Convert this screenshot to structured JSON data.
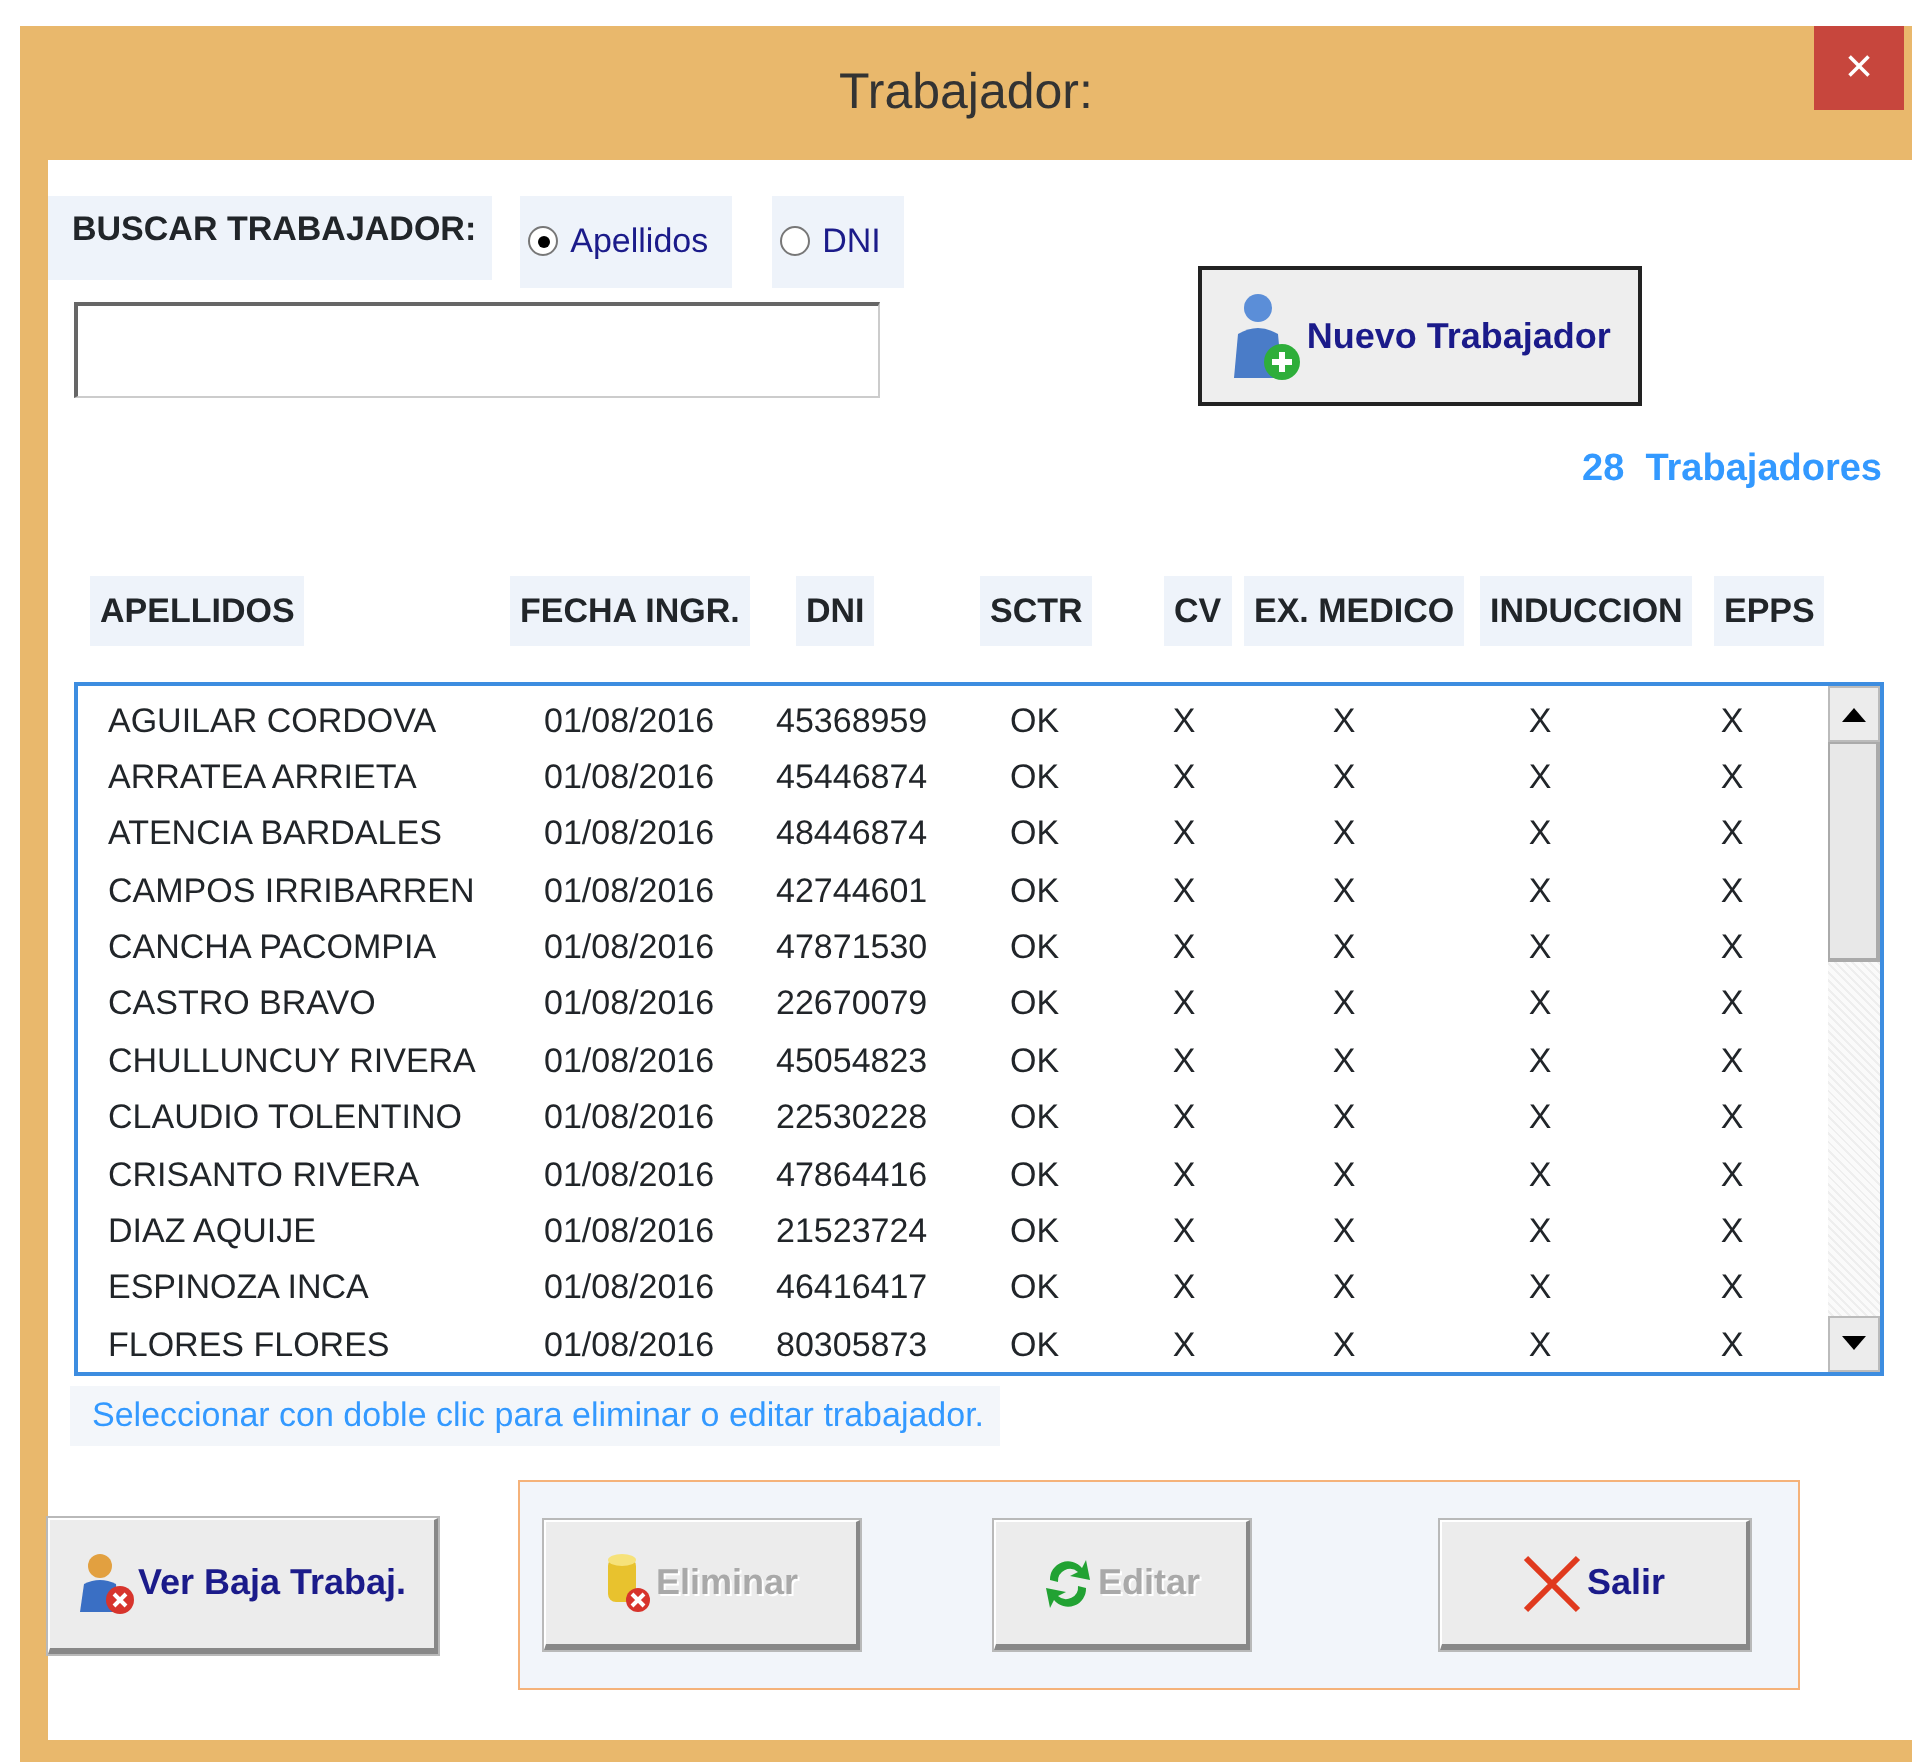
{
  "window": {
    "title": "Trabajador:",
    "close": "×"
  },
  "search": {
    "label": "BUSCAR TRABAJADOR:",
    "options": [
      {
        "label": "Apellidos",
        "selected": true
      },
      {
        "label": "DNI",
        "selected": false
      }
    ]
  },
  "new_button": {
    "label": "Nuevo Trabajador",
    "kind": "person-add"
  },
  "count": "28  Trabajadores",
  "table": {
    "columns": [
      "APELLIDOS",
      "FECHA INGR.",
      "DNI",
      "SCTR",
      "CV",
      "EX. MEDICO",
      "INDUCCION",
      "EPPS"
    ],
    "rows": [
      [
        "AGUILAR CORDOVA",
        "01/08/2016",
        "45368959",
        "OK",
        "X",
        "X",
        "X",
        "X"
      ],
      [
        "ARRATEA ARRIETA",
        "01/08/2016",
        "45446874",
        "OK",
        "X",
        "X",
        "X",
        "X"
      ],
      [
        "ATENCIA BARDALES",
        "01/08/2016",
        "48446874",
        "OK",
        "X",
        "X",
        "X",
        "X"
      ],
      [
        "CAMPOS IRRIBARREN",
        "01/08/2016",
        "42744601",
        "OK",
        "X",
        "X",
        "X",
        "X"
      ],
      [
        "CANCHA PACOMPIA",
        "01/08/2016",
        "47871530",
        "OK",
        "X",
        "X",
        "X",
        "X"
      ],
      [
        "CASTRO BRAVO",
        "01/08/2016",
        "22670079",
        "OK",
        "X",
        "X",
        "X",
        "X"
      ],
      [
        "CHULLUNCUY RIVERA",
        "01/08/2016",
        "45054823",
        "OK",
        "X",
        "X",
        "X",
        "X"
      ],
      [
        "CLAUDIO TOLENTINO",
        "01/08/2016",
        "22530228",
        "OK",
        "X",
        "X",
        "X",
        "X"
      ],
      [
        "CRISANTO RIVERA",
        "01/08/2016",
        "47864416",
        "OK",
        "X",
        "X",
        "X",
        "X"
      ],
      [
        "DIAZ AQUIJE",
        "01/08/2016",
        "21523724",
        "OK",
        "X",
        "X",
        "X",
        "X"
      ],
      [
        "ESPINOZA INCA",
        "01/08/2016",
        "46416417",
        "OK",
        "X",
        "X",
        "X",
        "X"
      ],
      [
        "FLORES FLORES",
        "01/08/2016",
        "80305873",
        "OK",
        "X",
        "X",
        "X",
        "X"
      ]
    ]
  },
  "hint": "Seleccionar con doble clic para eliminar o editar trabajador.",
  "side_button": {
    "label": "Ver Baja Trabaj.",
    "kind": "person-remove",
    "disabled": false
  },
  "actions": [
    {
      "label": "Eliminar",
      "kind": "delete",
      "disabled": true
    },
    {
      "label": "Editar",
      "kind": "refresh",
      "disabled": true
    },
    {
      "label": "Salir",
      "kind": "close",
      "disabled": false
    }
  ]
}
